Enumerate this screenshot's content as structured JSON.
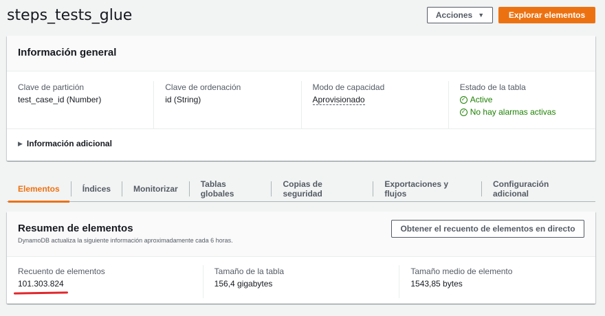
{
  "header": {
    "title": "steps_tests_glue",
    "actions_label": "Acciones",
    "explore_label": "Explorar elementos"
  },
  "general": {
    "title": "Información general",
    "columns": [
      {
        "label": "Clave de partición",
        "value": "test_case_id (Number)"
      },
      {
        "label": "Clave de ordenación",
        "value": "id (String)"
      },
      {
        "label": "Modo de capacidad",
        "value": "Aprovisionado"
      },
      {
        "label": "Estado de la tabla",
        "status_1": "Active",
        "status_2": "No hay alarmas activas"
      }
    ],
    "more_label": "Información adicional"
  },
  "tabs": [
    {
      "label": "Elementos",
      "active": true
    },
    {
      "label": "Índices"
    },
    {
      "label": "Monitorizar"
    },
    {
      "label": "Tablas globales"
    },
    {
      "label": "Copias de seguridad"
    },
    {
      "label": "Exportaciones y flujos"
    },
    {
      "label": "Configuración adicional"
    }
  ],
  "summary": {
    "title": "Resumen de elementos",
    "description": "DynamoDB actualiza la siguiente información aproximadamente cada 6 horas.",
    "count_button": "Obtener el recuento de elementos en directo",
    "columns": [
      {
        "label": "Recuento de elementos",
        "value": "101.303.824"
      },
      {
        "label": "Tamaño de la tabla",
        "value": "156,4 gigabytes"
      },
      {
        "label": "Tamaño medio de elemento",
        "value": "1543,85 bytes"
      }
    ]
  },
  "colors": {
    "accent": "#ec7211",
    "success": "#1d8102",
    "annotation": "#e0262b"
  }
}
